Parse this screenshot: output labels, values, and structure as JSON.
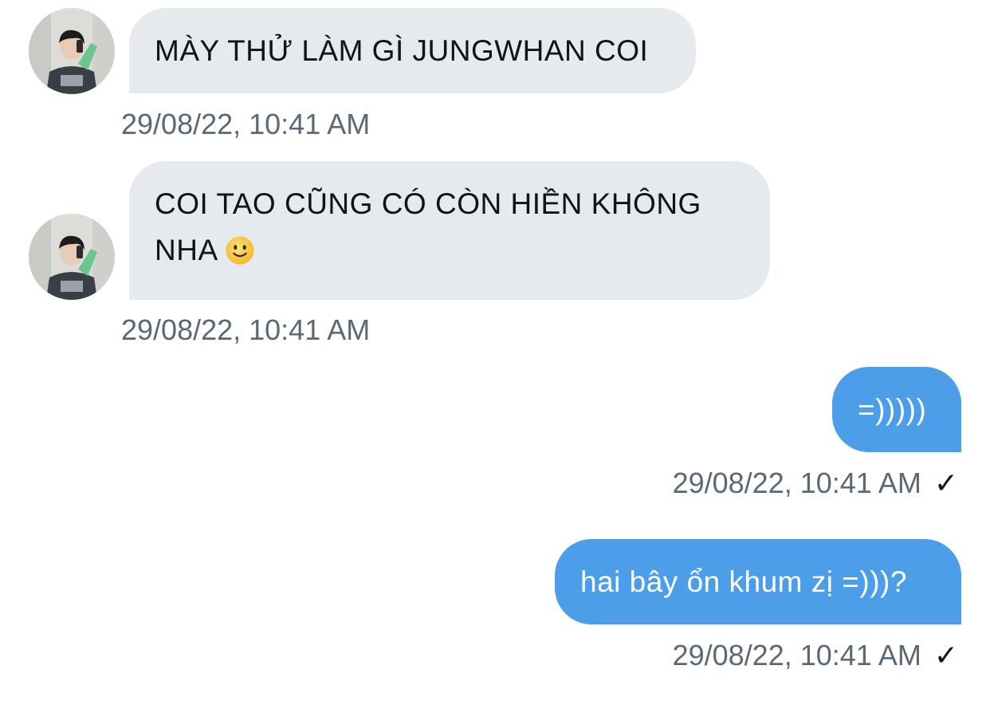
{
  "conversation": {
    "messages": [
      {
        "direction": "incoming",
        "text": "MÀY THỬ LÀM GÌ JUNGWHAN COI",
        "timestamp": "29/08/22, 10:41 AM"
      },
      {
        "direction": "incoming",
        "text": "COI TAO CŨNG CÓ CÒN HIỀN KHÔNG NHA",
        "emoji": "slightly-smiling-face",
        "timestamp": "29/08/22, 10:41 AM"
      },
      {
        "direction": "outgoing",
        "text": "=)))))",
        "timestamp": "29/08/22, 10:41 AM",
        "status": "✓"
      },
      {
        "direction": "outgoing",
        "text": "hai bây ổn khum zị =)))?",
        "timestamp": "29/08/22, 10:41 AM",
        "status": "✓"
      }
    ]
  },
  "colors": {
    "incoming_bubble": "#e6e9ed",
    "outgoing_bubble": "#4c9ee9",
    "timestamp": "#5b6877"
  }
}
